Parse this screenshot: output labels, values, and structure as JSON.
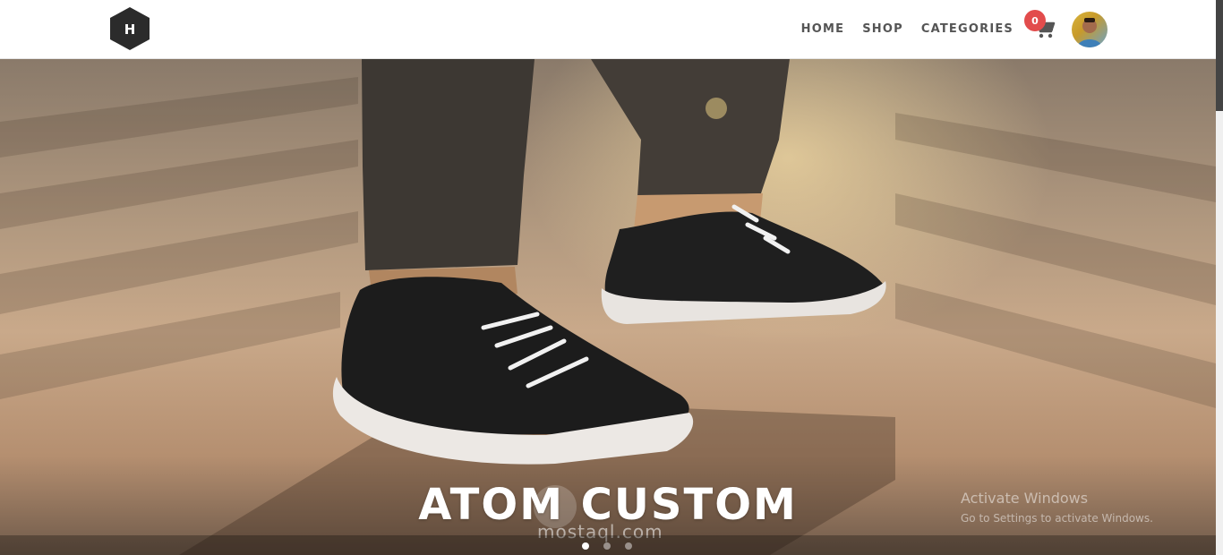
{
  "brand": {
    "logo_letter": "H"
  },
  "nav": {
    "home": "HOME",
    "shop": "SHOP",
    "categories": "CATEGORIES"
  },
  "cart": {
    "count": "0"
  },
  "hero": {
    "title": "ATOM CUSTOM",
    "slides": 3,
    "active_slide": 1
  },
  "watermark": "mostaql.com",
  "os_overlay": {
    "line1": "Activate Windows",
    "line2": "Go to Settings to activate Windows."
  },
  "colors": {
    "badge": "#e24c4c",
    "logo": "#2b2b2b",
    "nav_text": "#555555"
  },
  "icons": [
    "logo-hexagon-icon",
    "cart-icon",
    "user-avatar"
  ]
}
